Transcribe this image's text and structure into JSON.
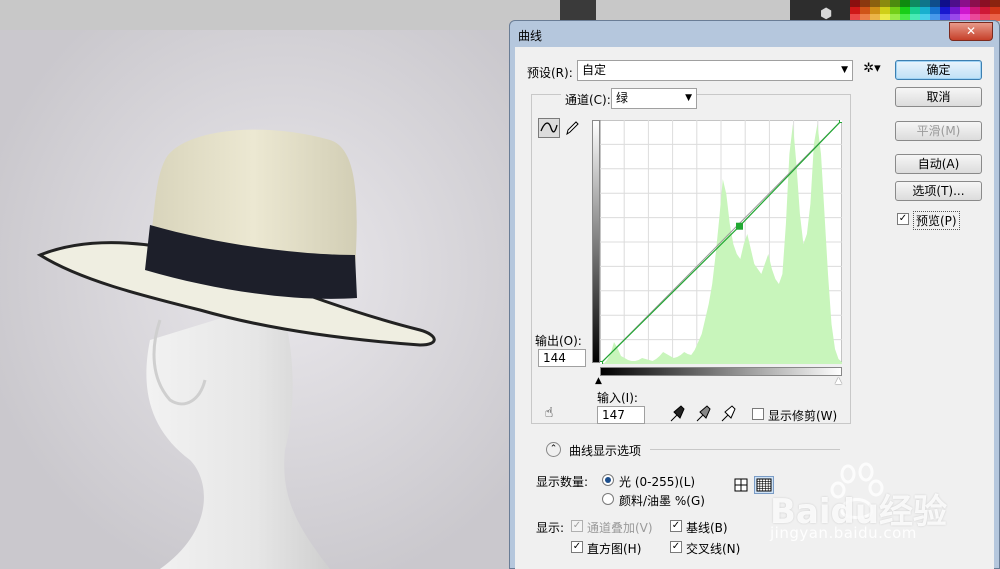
{
  "dialog": {
    "title": "曲线",
    "close_glyph": "✕",
    "preset_label": "预设(R):",
    "preset_value": "自定",
    "channel_label": "通道(C):",
    "channel_value": "绿",
    "output_label": "输出(O):",
    "output_value": "144",
    "input_label": "输入(I):",
    "input_value": "147",
    "show_clipping_label": "显示修剪(W)",
    "curve_options_label": "曲线显示选项",
    "show_amount_label": "显示数量:",
    "light_option": "光 (0-255)(L)",
    "pigment_option": "颜料/油墨 %(G)",
    "show_label": "显示:",
    "channel_overlay_label": "通道叠加(V)",
    "baseline_label": "基线(B)",
    "histogram_label": "直方图(H)",
    "intersection_label": "交叉线(N)"
  },
  "buttons": {
    "ok": "确定",
    "cancel": "取消",
    "smooth": "平滑(M)",
    "auto": "自动(A)",
    "options": "选项(T)...",
    "preview": "预览(P)"
  },
  "checks": {
    "show_clipping": false,
    "channel_overlay": true,
    "baseline": true,
    "histogram": true,
    "intersection": true,
    "preview": true
  },
  "colors": {
    "curve": "#22a833",
    "histogram": "#c8f5bb",
    "accent": "#3c7fb1"
  },
  "curve_points": [
    [
      0,
      0
    ],
    [
      147,
      144
    ],
    [
      255,
      255
    ]
  ],
  "icons": [
    "curve-point-icon",
    "pencil-icon",
    "gear-icon",
    "hand-adjust-icon",
    "eyedropper-black-icon",
    "eyedropper-gray-icon",
    "eyedropper-white-icon",
    "collapse-icon",
    "grid-4-icon",
    "grid-10-icon"
  ],
  "watermark": {
    "brand": "Baidu经验",
    "url": "jingyan.baidu.com"
  }
}
